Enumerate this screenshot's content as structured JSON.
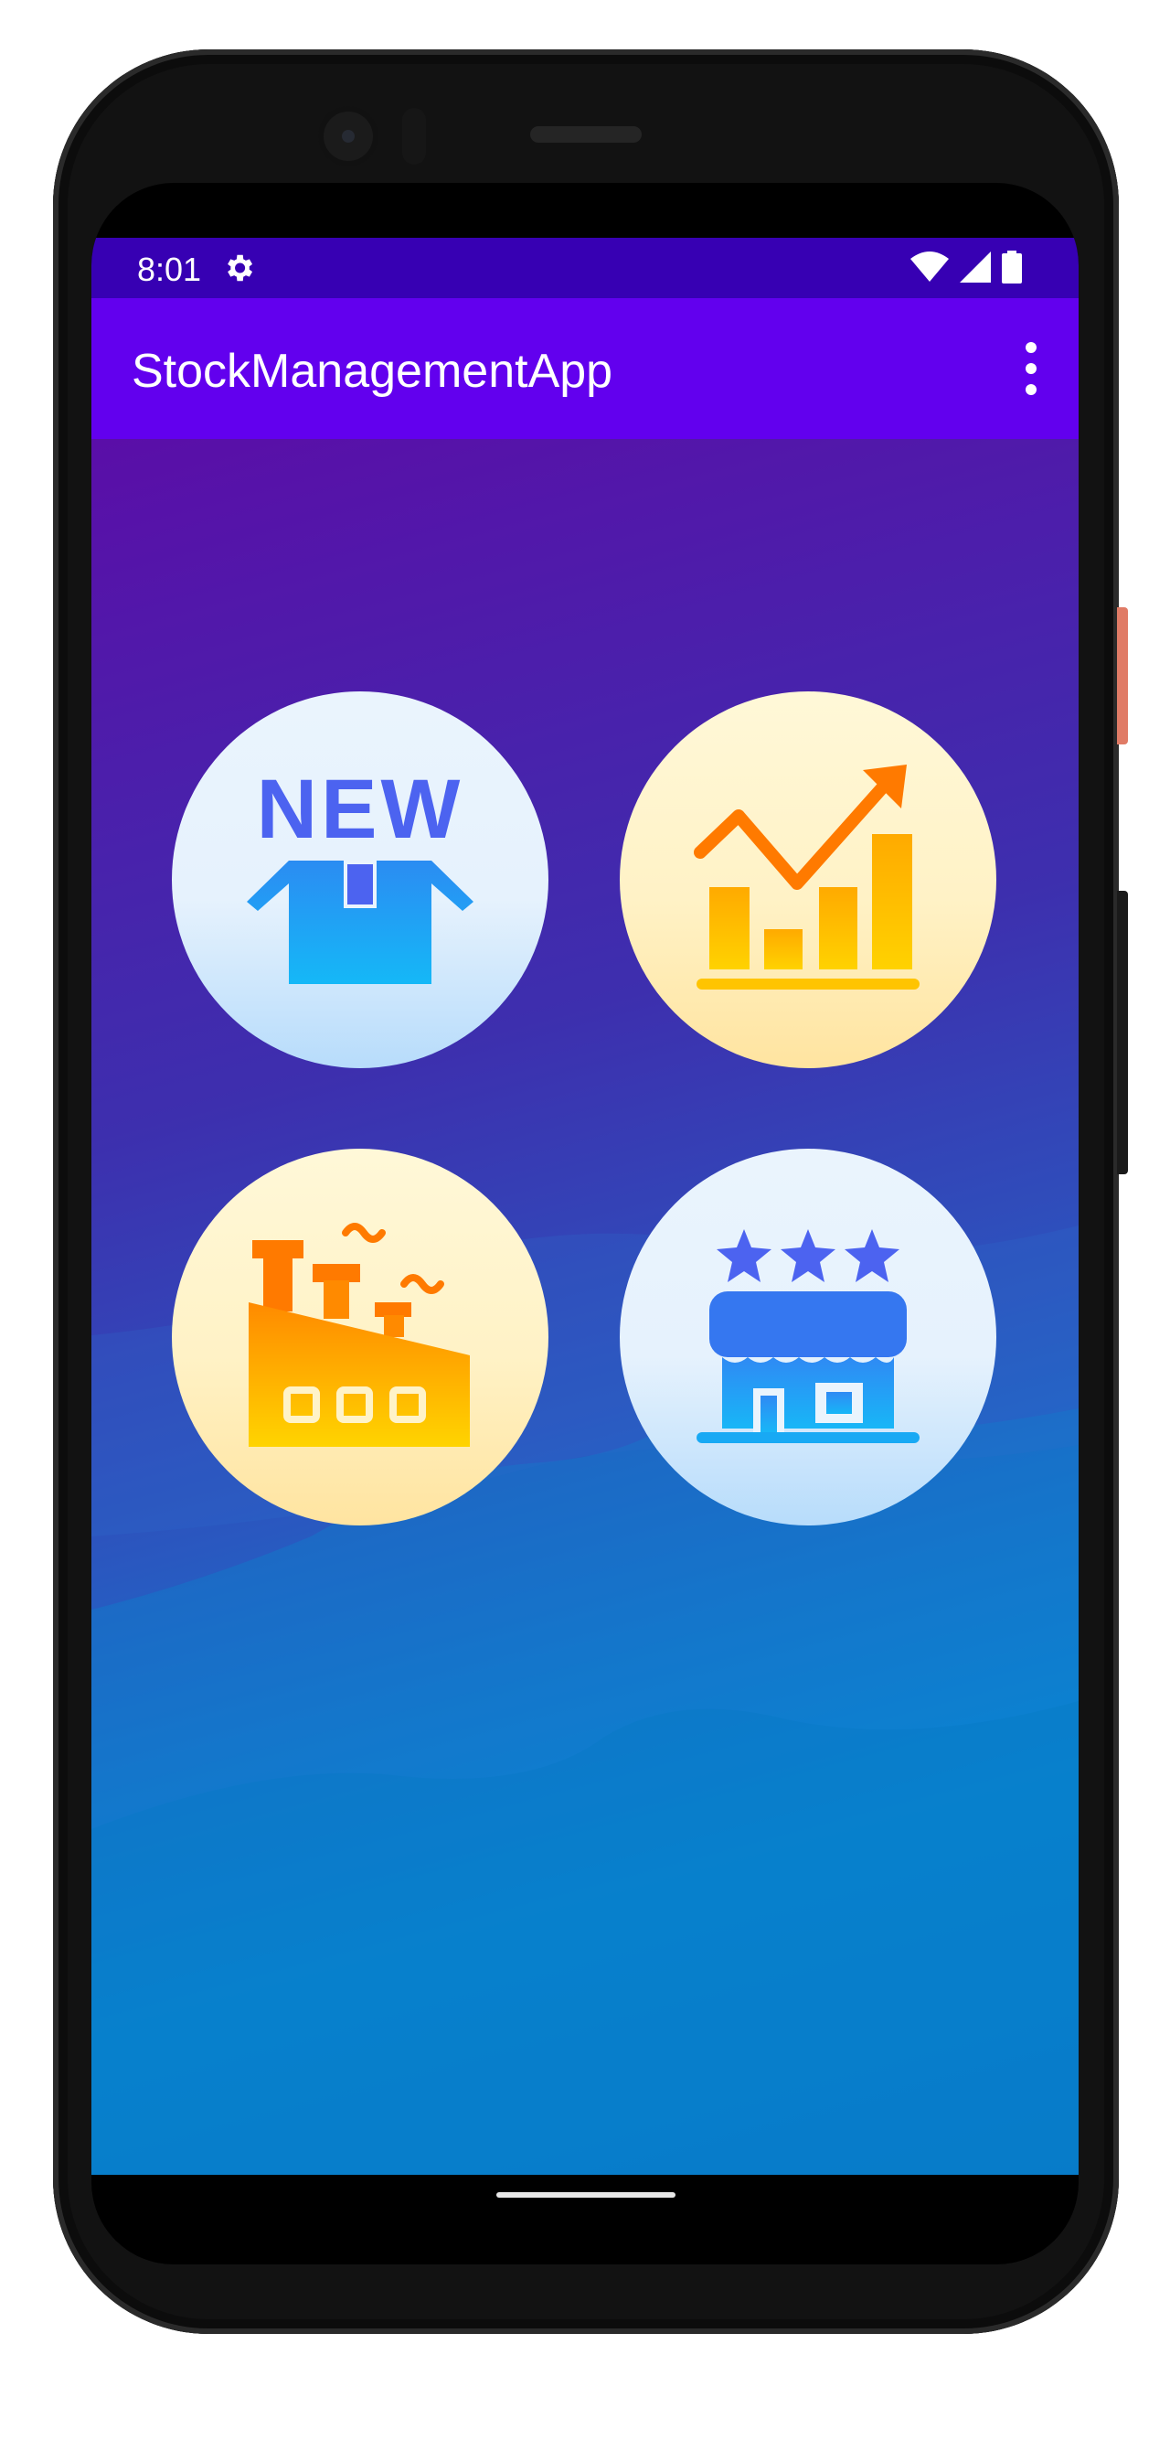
{
  "status_bar": {
    "time": "8:01",
    "icons": [
      "gear-icon",
      "wifi-icon",
      "cell-signal-icon",
      "battery-icon"
    ]
  },
  "app_bar": {
    "title": "StockManagementApp",
    "menu_icon": "overflow-menu-icon"
  },
  "tiles": [
    {
      "icon": "new-product-box-icon",
      "text": "NEW",
      "accent": "#4c63f0"
    },
    {
      "icon": "sales-growth-chart-icon",
      "accent": "#ff8a00"
    },
    {
      "icon": "factory-icon",
      "accent": "#ff8a00"
    },
    {
      "icon": "store-rating-icon",
      "accent": "#4c63f0"
    }
  ],
  "colors": {
    "status_bar": "#3700b3",
    "app_bar": "#6200ee",
    "background_top": "#5a0ea8",
    "background_bottom": "#0879cc"
  }
}
